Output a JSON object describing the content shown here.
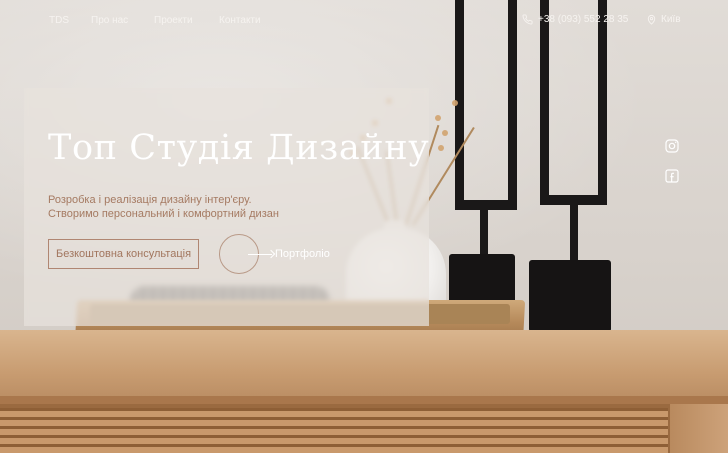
{
  "header": {
    "logo": "TDS",
    "nav": [
      "Про нас",
      "Проекти",
      "Контакти"
    ],
    "phone": "+38 (093) 552 28 35",
    "city": "Київ"
  },
  "hero": {
    "title": "Топ Студія Дизайну",
    "subtitle_lines": [
      "Розробка і реалізація дизайну інтер'єру.",
      "Створимо персональний і комфортний дизан"
    ],
    "consult_button": "Безкоштовна консультація",
    "portfolio_link": "Портфоліо"
  },
  "social": [
    "instagram-icon",
    "facebook-icon"
  ],
  "colors": {
    "accent": "#a57a62",
    "nav_text": "#f6f3f0",
    "title": "#ffffff"
  }
}
